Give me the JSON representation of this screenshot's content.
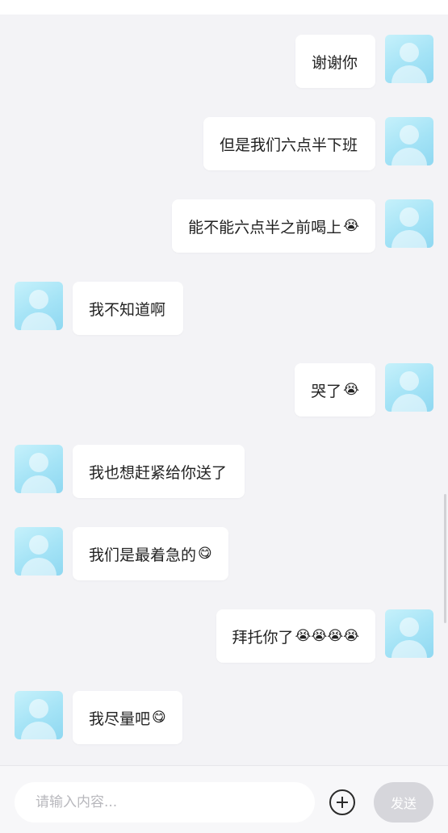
{
  "messages": [
    {
      "side": "right",
      "text": "谢谢你",
      "emoji": ""
    },
    {
      "side": "right",
      "text": "但是我们六点半下班",
      "emoji": ""
    },
    {
      "side": "right",
      "text": "能不能六点半之前喝上",
      "emoji": "😭"
    },
    {
      "side": "left",
      "text": "我不知道啊",
      "emoji": ""
    },
    {
      "side": "right",
      "text": "哭了",
      "emoji": "😭"
    },
    {
      "side": "left",
      "text": "我也想赶紧给你送了",
      "emoji": ""
    },
    {
      "side": "left",
      "text": "我们是最着急的",
      "emoji": "😋"
    },
    {
      "side": "right",
      "text": "拜托你了",
      "emoji": "😭😭😭😭"
    },
    {
      "side": "left",
      "text": "我尽量吧",
      "emoji": "😋"
    }
  ],
  "composer": {
    "placeholder": "请输入内容...",
    "send_label": "发送"
  },
  "icons": {
    "add": "plus-circle-icon",
    "avatar": "avatar-placeholder-icon"
  },
  "colors": {
    "background": "#f3f3f6",
    "bubble": "#ffffff",
    "avatar": "#a4e3f6",
    "send_disabled": "#d6d6db"
  }
}
